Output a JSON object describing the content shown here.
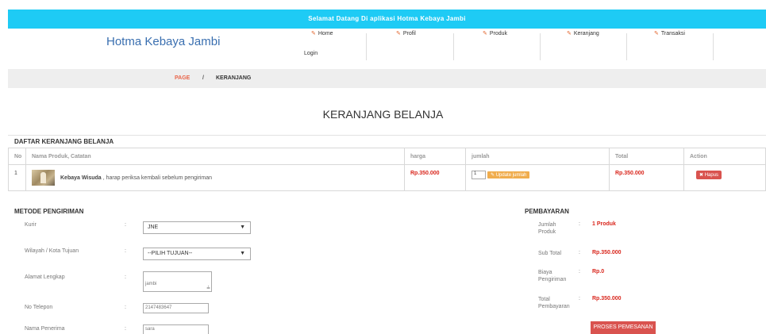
{
  "header": {
    "welcome": "Selamat Datang Di aplikasi Hotma Kebaya Jambi",
    "brand": "Hotma Kebaya Jambi",
    "nav": [
      "Home",
      "Profil",
      "Produk",
      "Keranjang",
      "Transaksi"
    ],
    "login": "Login"
  },
  "breadcrumb": {
    "page": "PAGE",
    "sep": "/",
    "current": "KERANJANG"
  },
  "title": "KERANJANG BELANJA",
  "cart": {
    "section_title": "DAFTAR KERANJANG BELANJA",
    "columns": [
      "No",
      "Nama Produk, Catatan",
      "harga",
      "jumlah",
      "Total",
      "Action"
    ],
    "rows": [
      {
        "no": "1",
        "name": "Kebaya Wisuda",
        "note": ", harap periksa kembali sebelum pengiriman",
        "price": "Rp.350.000",
        "qty": "1",
        "update_label": "Update jumlah",
        "total": "Rp.350.000",
        "delete_label": "Hapus"
      }
    ]
  },
  "shipping": {
    "title": "METODE PENGIRIMAN",
    "kurir_label": "Kurir",
    "kurir_value": "JNE",
    "wilayah_label": "Wilayah / Kota Tujuan",
    "wilayah_value": "--PILIH TUJUAN--",
    "alamat_label": "Alamat Lengkap",
    "alamat_value": "jambi",
    "telepon_label": "No Telepon",
    "telepon_value": "2147483647",
    "penerima_label": "Nama Penerima",
    "penerima_value": "sara",
    "colon": ":"
  },
  "payment": {
    "title": "PEMBAYARAN",
    "jumlah_label_1": "Jumlah",
    "jumlah_label_2": "Produk",
    "jumlah_value": "1 Produk",
    "subtotal_label": "Sub Total",
    "subtotal_value": "Rp.350.000",
    "biaya_label_1": "Biaya",
    "biaya_label_2": "Pengiriman",
    "biaya_value": "Rp.0",
    "total_label_1": "Total",
    "total_label_2": "Pembayaran",
    "total_value": "Rp.350.000",
    "process_label": "PROSES PEMESANAN",
    "colon": ":"
  },
  "colors": {
    "topbar": "#1ecbf5",
    "brand": "#3a6fb0",
    "accent": "#e9664a",
    "price": "#d9261c",
    "danger": "#d9534f",
    "warning": "#f0ad4e"
  }
}
